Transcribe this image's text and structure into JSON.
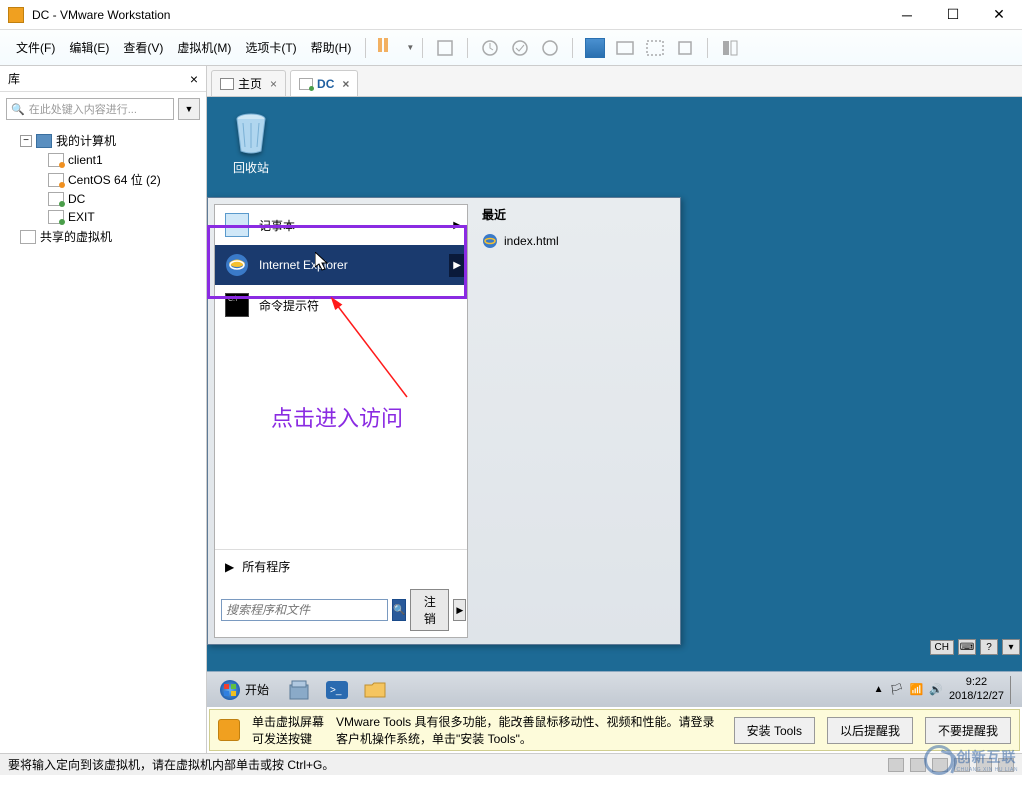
{
  "window": {
    "title": "DC - VMware Workstation"
  },
  "menu": {
    "file": "文件(F)",
    "edit": "编辑(E)",
    "view": "查看(V)",
    "vm": "虚拟机(M)",
    "tabs": "选项卡(T)",
    "help": "帮助(H)"
  },
  "library": {
    "header": "库",
    "search_placeholder": "在此处键入内容进行...",
    "tree": {
      "my_computer": "我的计算机",
      "client1": "client1",
      "centos": "CentOS 64 位 (2)",
      "dc": "DC",
      "exit": "EXIT",
      "shared": "共享的虚拟机"
    }
  },
  "tabs": {
    "home": "主页",
    "dc": "DC"
  },
  "desktop": {
    "recycle_bin": "回收站"
  },
  "start_menu": {
    "notepad": "记事本",
    "ie": "Internet Explorer",
    "cmd": "命令提示符",
    "all_programs": "所有程序",
    "search_placeholder": "搜索程序和文件",
    "logout": "注销",
    "recent_header": "最近",
    "recent_item": "index.html"
  },
  "annotation": {
    "text": "点击进入访问"
  },
  "taskbar": {
    "start": "开始",
    "time": "9:22",
    "date": "2018/12/27",
    "lang": "CH"
  },
  "tools_bar": {
    "line1": "单击虚拟屏幕",
    "line2": "可发送按键",
    "msg": "VMware Tools 具有很多功能，能改善鼠标移动性、视频和性能。请登录客户机操作系统，单击\"安装 Tools\"。",
    "install": "安装 Tools",
    "remind_later": "以后提醒我",
    "dont_remind": "不要提醒我"
  },
  "status": {
    "text": "要将输入定向到该虚拟机，请在虚拟机内部单击或按 Ctrl+G。"
  },
  "watermark": {
    "main": "创新互联",
    "sub": "CHUANG XIN HU LIAN"
  }
}
